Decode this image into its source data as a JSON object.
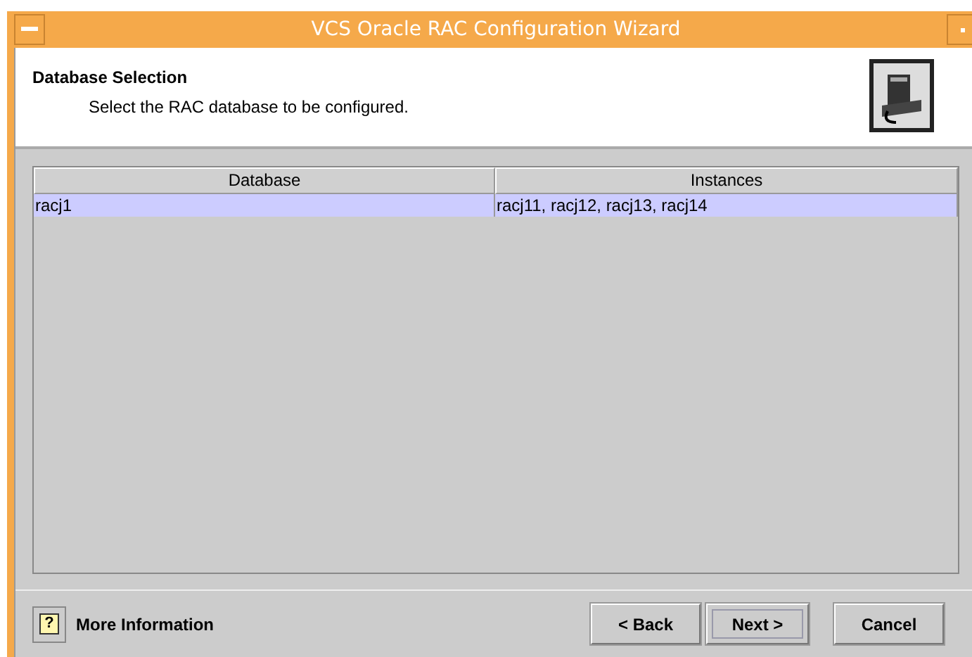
{
  "window": {
    "title": "VCS Oracle RAC Configuration Wizard"
  },
  "header": {
    "title": "Database Selection",
    "subtitle": "Select the RAC database to be configured."
  },
  "table": {
    "columns": [
      "Database",
      "Instances"
    ],
    "rows": [
      {
        "cells": [
          "racj1",
          "racj11, racj12, racj13, racj14"
        ],
        "selected": true
      }
    ]
  },
  "footer": {
    "help_icon": "?",
    "help_label": "More Information",
    "buttons": [
      {
        "label": "< Back",
        "focused": false
      },
      {
        "label": "Next >",
        "focused": true
      },
      {
        "label": "Cancel",
        "focused": false
      }
    ]
  }
}
